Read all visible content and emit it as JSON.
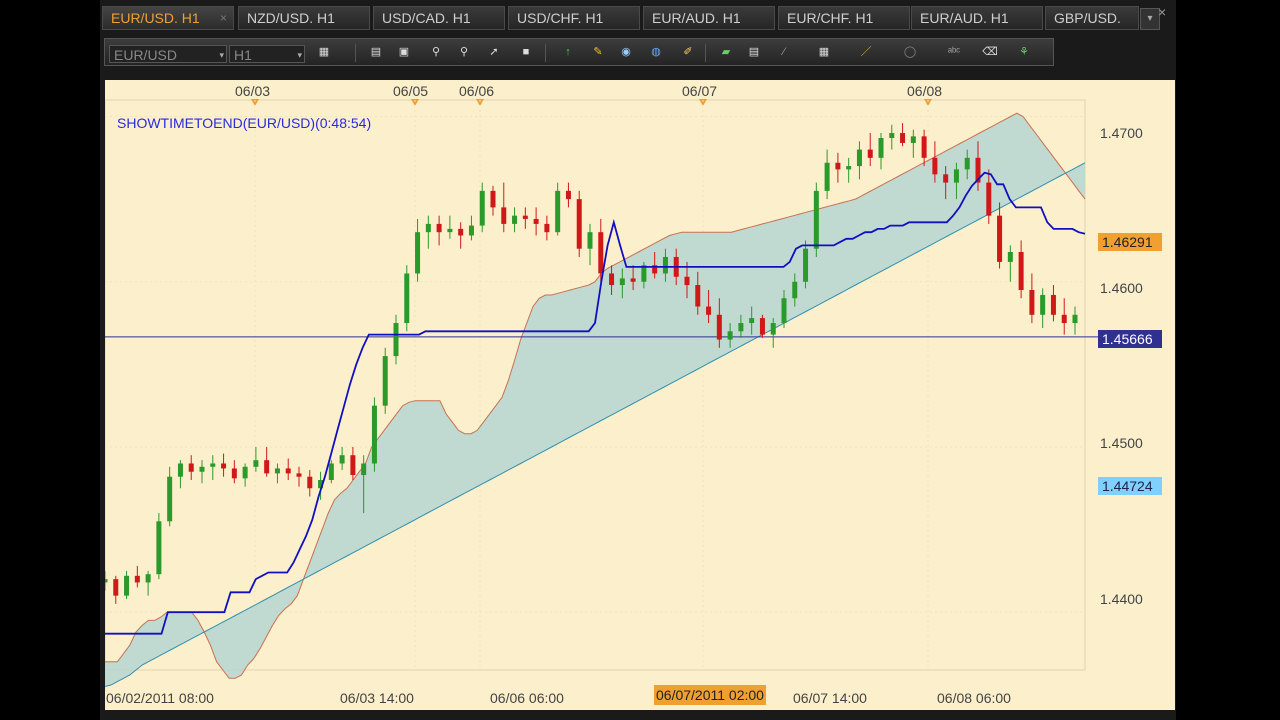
{
  "tabs": [
    {
      "label": "EUR/USD. H1",
      "active": true,
      "close": "×"
    },
    {
      "label": "NZD/USD. H1"
    },
    {
      "label": "USD/CAD. H1"
    },
    {
      "label": "USD/CHF. H1"
    },
    {
      "label": "EUR/AUD. H1"
    },
    {
      "label": "EUR/CHF. H1"
    },
    {
      "label": "EUR/AUD. H1"
    },
    {
      "label": "GBP/USD."
    }
  ],
  "toolbar": {
    "symbol": "EUR/USD",
    "timeframe": "H1"
  },
  "indicator": "SHOWTIMETOEND(EUR/USD)(0:48:54)",
  "date_labels": [
    "06/03",
    "06/05",
    "06/06",
    "06/07",
    "06/08"
  ],
  "time_labels": [
    "06/02/2011 08:00",
    "06/03 14:00",
    "06/06 06:00",
    "06/07 14:00",
    "06/08 06:00"
  ],
  "time_highlight": "06/07/2011 02:00",
  "price_labels": {
    "p1": "1.4700",
    "p2": "1.4600",
    "p3": "1.4500",
    "p4": "1.4400",
    "current": "1.46291",
    "line": "1.45666",
    "cyan": "1.44724"
  },
  "colors": {
    "background": "#fbefcc",
    "bull": "#2a9a2a",
    "bear": "#d01818",
    "tenkan": "#1010c0",
    "cloud_bull": "#b9d6d2",
    "cloud_bear": "#f2bfa2",
    "current_price": "#f0a030",
    "line_price": "#303090",
    "cyan_price": "#80d0ff"
  },
  "chart_data": {
    "type": "line",
    "ylim": [
      1.4365,
      1.471
    ],
    "tenkan": [
      1.4387,
      1.4387,
      1.4387,
      1.4387,
      1.4387,
      1.4387,
      1.4387,
      1.4387,
      1.4387,
      1.4387,
      1.44,
      1.44,
      1.44,
      1.44,
      1.44,
      1.44,
      1.44,
      1.44,
      1.44,
      1.44,
      1.4412,
      1.4412,
      1.4412,
      1.4412,
      1.442,
      1.4422,
      1.4424,
      1.4424,
      1.4424,
      1.4424,
      1.443,
      1.4438,
      1.4446,
      1.4456,
      1.447,
      1.4482,
      1.4496,
      1.451,
      1.4524,
      1.4538,
      1.455,
      1.456,
      1.4568,
      1.4568,
      1.4568,
      1.4568,
      1.4568,
      1.4568,
      1.4568,
      1.4568,
      1.4568,
      1.457,
      1.457,
      1.457,
      1.457,
      1.457,
      1.457,
      1.457,
      1.457,
      1.457,
      1.457,
      1.457,
      1.457,
      1.457,
      1.457,
      1.457,
      1.457,
      1.457,
      1.457,
      1.457,
      1.457,
      1.457,
      1.457,
      1.457,
      1.457,
      1.457,
      1.457,
      1.457,
      1.4575,
      1.46,
      1.4622,
      1.4636,
      1.4622,
      1.4609,
      1.4609,
      1.4609,
      1.4609,
      1.4609,
      1.4609,
      1.4609,
      1.4609,
      1.4609,
      1.4609,
      1.4609,
      1.4609,
      1.4609,
      1.4609,
      1.4609,
      1.4609,
      1.4609,
      1.4609,
      1.4609,
      1.4609,
      1.4609,
      1.4609,
      1.4609,
      1.4609,
      1.4609,
      1.4609,
      1.4612,
      1.462,
      1.4622,
      1.4622,
      1.4622,
      1.4622,
      1.4622,
      1.4622,
      1.4624,
      1.4626,
      1.4626,
      1.4628,
      1.463,
      1.463,
      1.4632,
      1.4632,
      1.4634,
      1.4634,
      1.4634,
      1.4636,
      1.4636,
      1.4636,
      1.4636,
      1.4636,
      1.4636,
      1.4636,
      1.464,
      1.4645,
      1.4652,
      1.4658,
      1.4662,
      1.4666,
      1.4665,
      1.4659,
      1.4659,
      1.465,
      1.4645,
      1.4645,
      1.4645,
      1.4645,
      1.4645,
      1.4636,
      1.4632,
      1.4632,
      1.4632,
      1.4632,
      1.463,
      1.4629
    ],
    "cloud_upper": [
      1.437,
      1.437,
      1.437,
      1.4375,
      1.438,
      1.4388,
      1.4392,
      1.4395,
      1.4395,
      1.4397,
      1.44,
      1.44,
      1.44,
      1.44,
      1.44,
      1.4395,
      1.4388,
      1.438,
      1.437,
      1.4365,
      1.436,
      1.436,
      1.4362,
      1.4368,
      1.4372,
      1.4378,
      1.4385,
      1.4392,
      1.4398,
      1.4402,
      1.4405,
      1.441,
      1.442,
      1.443,
      1.444,
      1.445,
      1.446,
      1.4468,
      1.4472,
      1.4475,
      1.448,
      1.4485,
      1.449,
      1.45,
      1.4505,
      1.451,
      1.4515,
      1.452,
      1.4525,
      1.4527,
      1.4528,
      1.4528,
      1.4528,
      1.4528,
      1.4528,
      1.452,
      1.4515,
      1.451,
      1.4508,
      1.4508,
      1.451,
      1.4515,
      1.452,
      1.4525,
      1.453,
      1.454,
      1.4552,
      1.4565,
      1.4575,
      1.4585,
      1.459,
      1.4592,
      1.4592,
      1.4593,
      1.4594,
      1.4595,
      1.4596,
      1.4597,
      1.4598,
      1.46,
      1.4605,
      1.4608,
      1.461,
      1.4612,
      1.4614,
      1.4616,
      1.4618,
      1.462,
      1.4622,
      1.4624,
      1.4626,
      1.4628,
      1.4629,
      1.463,
      1.463,
      1.463,
      1.463,
      1.463,
      1.463,
      1.463,
      1.463,
      1.463,
      1.4631,
      1.4632,
      1.4633,
      1.4634,
      1.4635,
      1.4636,
      1.4637,
      1.4638,
      1.4639,
      1.464,
      1.4641,
      1.4642,
      1.4643,
      1.4644,
      1.4645,
      1.4646,
      1.4647,
      1.4648,
      1.4649,
      1.465,
      1.4652,
      1.4654,
      1.4656,
      1.4658,
      1.466,
      1.4662,
      1.4664,
      1.4666,
      1.4668,
      1.467,
      1.4672,
      1.4674,
      1.4676,
      1.4678,
      1.468,
      1.4682,
      1.4684,
      1.4686,
      1.4688,
      1.469,
      1.4692,
      1.4694,
      1.4696,
      1.4698,
      1.47,
      1.4702,
      1.47,
      1.4695,
      1.469,
      1.4685,
      1.468,
      1.4675,
      1.467,
      1.4665,
      1.466,
      1.4655,
      1.465
    ],
    "cloud_lower": [
      1.4355,
      1.4356,
      1.4358,
      1.436,
      1.4362,
      1.4365,
      1.4368,
      1.437,
      1.4372,
      1.4374,
      1.4376,
      1.4378,
      1.438,
      1.4382,
      1.4384,
      1.4386,
      1.4388,
      1.439,
      1.4392,
      1.4394,
      1.4396,
      1.4398,
      1.44,
      1.4402,
      1.4404,
      1.4406,
      1.4408,
      1.441,
      1.4412,
      1.4414,
      1.4416,
      1.4418,
      1.442,
      1.4422,
      1.4424,
      1.4426,
      1.4428,
      1.443,
      1.4432,
      1.4434,
      1.4436,
      1.4438,
      1.444,
      1.4442,
      1.4444,
      1.4446,
      1.4448,
      1.445,
      1.4452,
      1.4454,
      1.4456,
      1.4458,
      1.446,
      1.4462,
      1.4464,
      1.4466,
      1.4468,
      1.447,
      1.4472,
      1.4474,
      1.4476,
      1.4478,
      1.448,
      1.4482,
      1.4484,
      1.4486,
      1.4488,
      1.449,
      1.4492,
      1.4494,
      1.4496,
      1.4498,
      1.45,
      1.4502,
      1.4504,
      1.4506,
      1.4508,
      1.451,
      1.4512,
      1.4514,
      1.4516,
      1.4518,
      1.452,
      1.4522,
      1.4524,
      1.4526,
      1.4528,
      1.453,
      1.4532,
      1.4534,
      1.4536,
      1.4538,
      1.454,
      1.4542,
      1.4544,
      1.4546,
      1.4548,
      1.455,
      1.4552,
      1.4554,
      1.4556,
      1.4558,
      1.456,
      1.4562,
      1.4564,
      1.4566,
      1.4568,
      1.457,
      1.4572,
      1.4574,
      1.4576,
      1.4578,
      1.458,
      1.4582,
      1.4584,
      1.4586,
      1.4588,
      1.459,
      1.4592,
      1.4594,
      1.4596,
      1.4598,
      1.46,
      1.4602,
      1.4604,
      1.4606,
      1.4608,
      1.461,
      1.4612,
      1.4614,
      1.4616,
      1.4618,
      1.462,
      1.4622,
      1.4624,
      1.4626,
      1.4628,
      1.463,
      1.4632,
      1.4634,
      1.4636,
      1.4638,
      1.464,
      1.4642,
      1.4644,
      1.4646,
      1.4648,
      1.465,
      1.4652,
      1.4654,
      1.4656,
      1.4658,
      1.466,
      1.4662,
      1.4664,
      1.4666,
      1.4668,
      1.467,
      1.4672,
      1.4674,
      1.4676
    ],
    "candles": [
      [
        1.4418,
        1.4425,
        1.4413,
        1.442
      ],
      [
        1.442,
        1.4422,
        1.4405,
        1.441
      ],
      [
        1.441,
        1.4425,
        1.4408,
        1.4422
      ],
      [
        1.4422,
        1.4428,
        1.4415,
        1.4418
      ],
      [
        1.4418,
        1.4425,
        1.441,
        1.4423
      ],
      [
        1.4423,
        1.446,
        1.442,
        1.4455
      ],
      [
        1.4455,
        1.4488,
        1.4452,
        1.4482
      ],
      [
        1.4482,
        1.4492,
        1.4475,
        1.449
      ],
      [
        1.449,
        1.4495,
        1.448,
        1.4485
      ],
      [
        1.4485,
        1.4492,
        1.4478,
        1.4488
      ],
      [
        1.4488,
        1.4495,
        1.448,
        1.449
      ],
      [
        1.449,
        1.4496,
        1.4482,
        1.4487
      ],
      [
        1.4487,
        1.4492,
        1.4478,
        1.4481
      ],
      [
        1.4481,
        1.449,
        1.4476,
        1.4488
      ],
      [
        1.4488,
        1.45,
        1.4485,
        1.4492
      ],
      [
        1.4492,
        1.45,
        1.4482,
        1.4484
      ],
      [
        1.4484,
        1.449,
        1.4478,
        1.4487
      ],
      [
        1.4487,
        1.4493,
        1.448,
        1.4484
      ],
      [
        1.4484,
        1.4488,
        1.4476,
        1.4482
      ],
      [
        1.4482,
        1.4486,
        1.447,
        1.4475
      ],
      [
        1.4475,
        1.4485,
        1.4468,
        1.448
      ],
      [
        1.448,
        1.4492,
        1.4478,
        1.449
      ],
      [
        1.449,
        1.45,
        1.4486,
        1.4495
      ],
      [
        1.4495,
        1.45,
        1.448,
        1.4483
      ],
      [
        1.4483,
        1.4495,
        1.446,
        1.449
      ],
      [
        1.449,
        1.453,
        1.4485,
        1.4525
      ],
      [
        1.4525,
        1.456,
        1.452,
        1.4555
      ],
      [
        1.4555,
        1.458,
        1.455,
        1.4575
      ],
      [
        1.4575,
        1.461,
        1.457,
        1.4605
      ],
      [
        1.4605,
        1.4638,
        1.46,
        1.463
      ],
      [
        1.463,
        1.464,
        1.462,
        1.4635
      ],
      [
        1.4635,
        1.464,
        1.4622,
        1.463
      ],
      [
        1.463,
        1.464,
        1.4626,
        1.4632
      ],
      [
        1.4632,
        1.4636,
        1.462,
        1.4628
      ],
      [
        1.4628,
        1.464,
        1.4625,
        1.4634
      ],
      [
        1.4634,
        1.466,
        1.463,
        1.4655
      ],
      [
        1.4655,
        1.4658,
        1.464,
        1.4645
      ],
      [
        1.4645,
        1.466,
        1.463,
        1.4635
      ],
      [
        1.4635,
        1.4645,
        1.463,
        1.464
      ],
      [
        1.464,
        1.4645,
        1.4632,
        1.4638
      ],
      [
        1.4638,
        1.4645,
        1.4628,
        1.4635
      ],
      [
        1.4635,
        1.464,
        1.4625,
        1.463
      ],
      [
        1.463,
        1.466,
        1.4628,
        1.4655
      ],
      [
        1.4655,
        1.466,
        1.4645,
        1.465
      ],
      [
        1.465,
        1.4655,
        1.4615,
        1.462
      ],
      [
        1.462,
        1.4635,
        1.461,
        1.463
      ],
      [
        1.463,
        1.4638,
        1.46,
        1.4605
      ],
      [
        1.4605,
        1.461,
        1.4592,
        1.4598
      ],
      [
        1.4598,
        1.4608,
        1.459,
        1.4602
      ],
      [
        1.4602,
        1.461,
        1.4595,
        1.46
      ],
      [
        1.46,
        1.4612,
        1.4596,
        1.461
      ],
      [
        1.461,
        1.4618,
        1.4602,
        1.4605
      ],
      [
        1.4605,
        1.462,
        1.46,
        1.4615
      ],
      [
        1.4615,
        1.462,
        1.4598,
        1.4603
      ],
      [
        1.4603,
        1.4612,
        1.459,
        1.4598
      ],
      [
        1.4598,
        1.4606,
        1.458,
        1.4585
      ],
      [
        1.4585,
        1.4595,
        1.4575,
        1.458
      ],
      [
        1.458,
        1.459,
        1.456,
        1.4565
      ],
      [
        1.4565,
        1.4575,
        1.456,
        1.457
      ],
      [
        1.457,
        1.458,
        1.4566,
        1.4575
      ],
      [
        1.4575,
        1.4585,
        1.4568,
        1.4578
      ],
      [
        1.4578,
        1.458,
        1.4566,
        1.4568
      ],
      [
        1.4568,
        1.4578,
        1.456,
        1.4575
      ],
      [
        1.4575,
        1.4595,
        1.4572,
        1.459
      ],
      [
        1.459,
        1.4605,
        1.4585,
        1.46
      ],
      [
        1.46,
        1.4625,
        1.4596,
        1.462
      ],
      [
        1.462,
        1.466,
        1.4615,
        1.4655
      ],
      [
        1.4655,
        1.468,
        1.465,
        1.4672
      ],
      [
        1.4672,
        1.4678,
        1.466,
        1.4668
      ],
      [
        1.4668,
        1.4675,
        1.466,
        1.467
      ],
      [
        1.467,
        1.4685,
        1.4662,
        1.468
      ],
      [
        1.468,
        1.469,
        1.467,
        1.4675
      ],
      [
        1.4675,
        1.469,
        1.4668,
        1.4687
      ],
      [
        1.4687,
        1.4695,
        1.468,
        1.469
      ],
      [
        1.469,
        1.4696,
        1.4682,
        1.4684
      ],
      [
        1.4684,
        1.4692,
        1.4675,
        1.4688
      ],
      [
        1.4688,
        1.4692,
        1.467,
        1.4675
      ],
      [
        1.4675,
        1.4685,
        1.466,
        1.4665
      ],
      [
        1.4665,
        1.467,
        1.465,
        1.466
      ],
      [
        1.466,
        1.4672,
        1.465,
        1.4668
      ],
      [
        1.4668,
        1.468,
        1.4662,
        1.4675
      ],
      [
        1.4675,
        1.4685,
        1.4655,
        1.466
      ],
      [
        1.466,
        1.4668,
        1.4635,
        1.464
      ],
      [
        1.464,
        1.4648,
        1.4608,
        1.4612
      ],
      [
        1.4612,
        1.4622,
        1.46,
        1.4618
      ],
      [
        1.4618,
        1.4625,
        1.459,
        1.4595
      ],
      [
        1.4595,
        1.4605,
        1.4575,
        1.458
      ],
      [
        1.458,
        1.4596,
        1.4572,
        1.4592
      ],
      [
        1.4592,
        1.4598,
        1.4576,
        1.458
      ],
      [
        1.458,
        1.459,
        1.4568,
        1.4575
      ],
      [
        1.4575,
        1.4585,
        1.4568,
        1.458
      ]
    ]
  }
}
